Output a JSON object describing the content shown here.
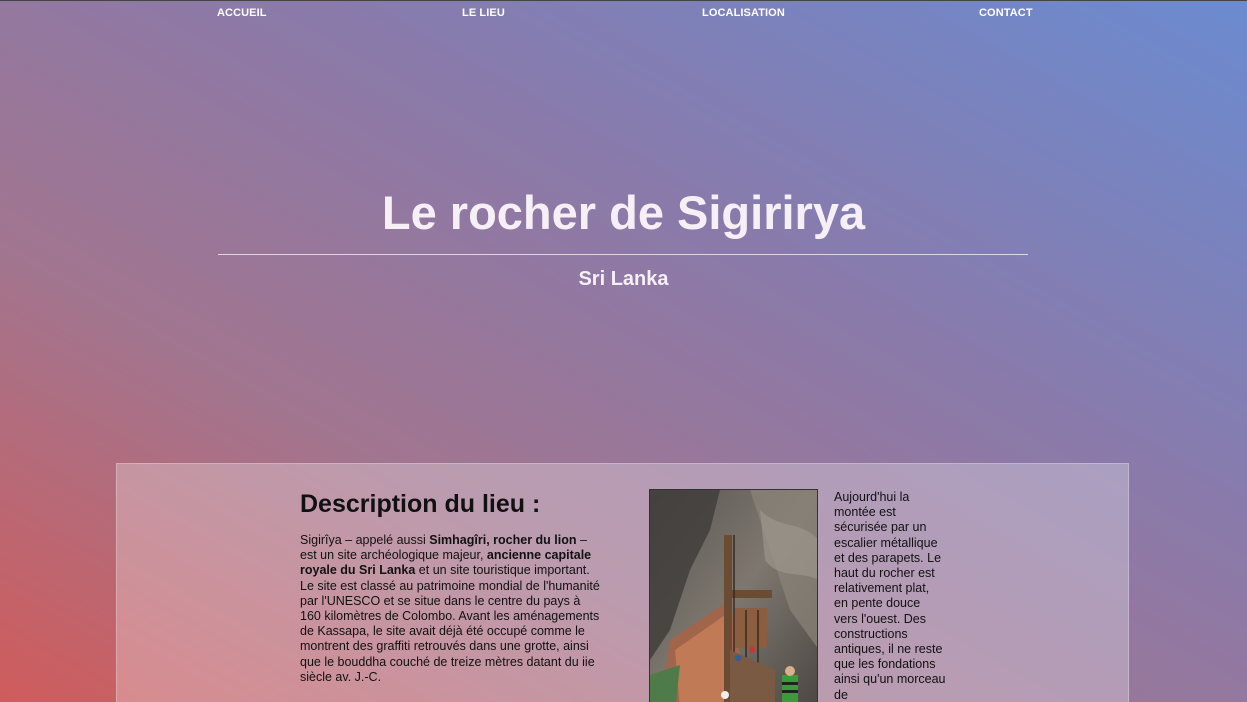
{
  "nav": {
    "items": [
      {
        "label": "ACCUEIL"
      },
      {
        "label": "LE LIEU"
      },
      {
        "label": "LOCALISATION"
      },
      {
        "label": "CONTACT"
      }
    ]
  },
  "hero": {
    "title": "Le rocher de Sigirirya",
    "subtitle": "Sri Lanka"
  },
  "description": {
    "heading": "Description du lieu :",
    "p1_a": "Sigirîya – appelé aussi ",
    "p1_b": "Simhagîri, rocher du lion",
    "p1_c": " – est un site archéologique majeur, ",
    "p1_d": "ancienne capitale royale du Sri Lanka",
    "p1_e": " et un site touristique important. Le site est classé au patrimoine mondial de l'humanité par l'UNESCO et se situe dans le centre du pays à 160 kilomètres de Colombo. Avant les aménagements de Kassapa, le site avait déjà été occupé comme le montrent des graffiti retrouvés dans une grotte, ainsi que le bouddha couché de treize mètres datant du iie siècle av. J.-C."
  },
  "side": {
    "text": "Aujourd'hui la montée est sécurisée par un escalier métallique et des parapets. Le haut du rocher est relativement plat, en pente douce vers l'ouest. Des constructions antiques, il ne reste que les fondations ainsi qu'un morceau de"
  },
  "colors": {
    "gradient_start": "#cf5c5c",
    "gradient_end": "#6b8bd0"
  },
  "image": {
    "icon": "rock-staircase-photo"
  }
}
